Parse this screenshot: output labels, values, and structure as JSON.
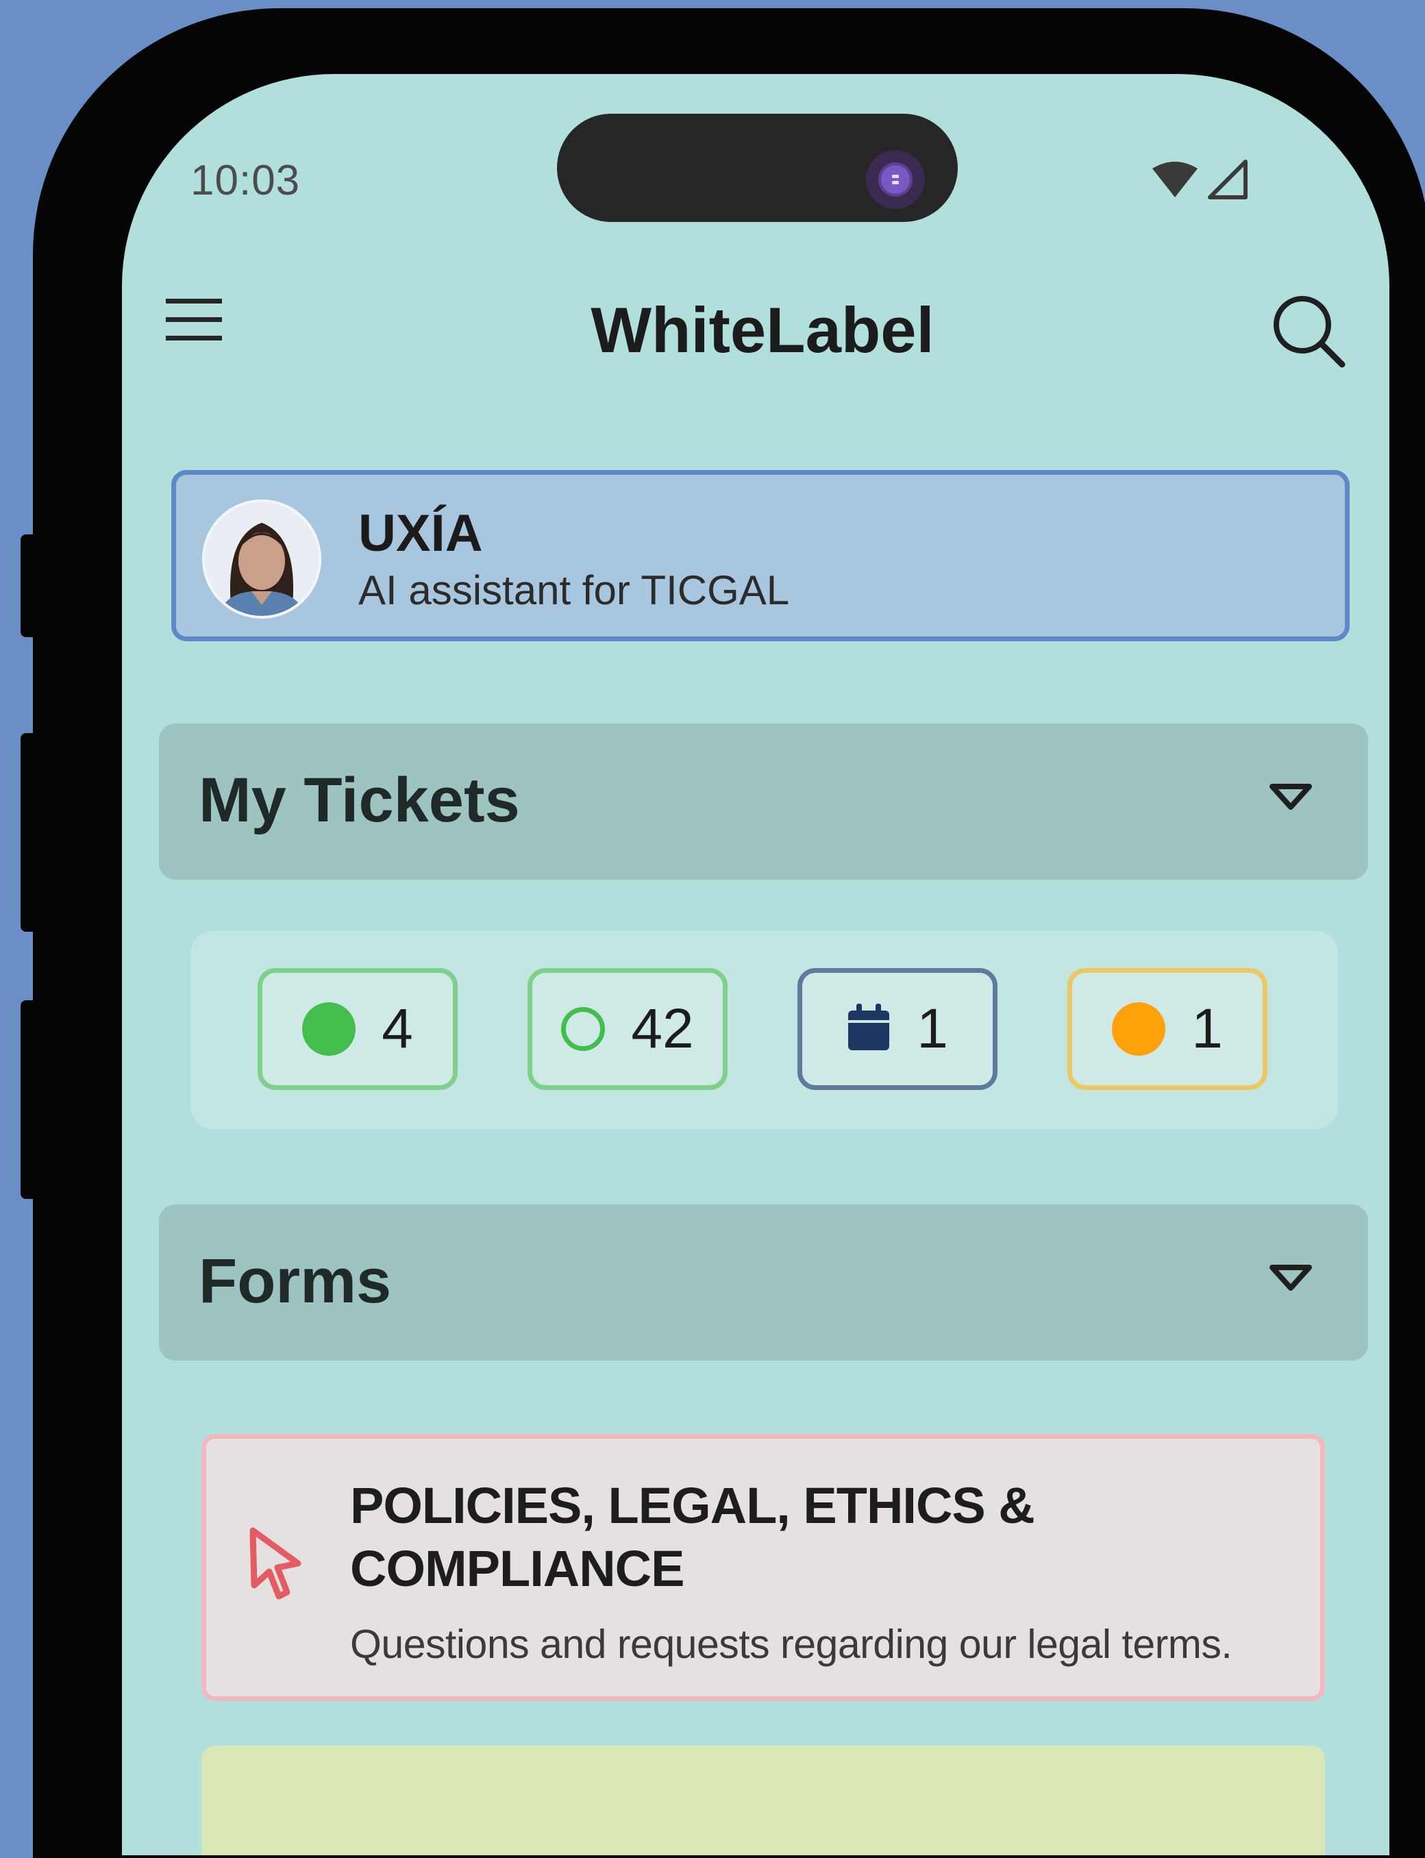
{
  "status_bar": {
    "time": "10:03"
  },
  "app_bar": {
    "title": "WhiteLabel",
    "menu_icon": "hamburger-menu-icon",
    "search_icon": "search-icon"
  },
  "assistant": {
    "name": "UXÍA",
    "subtitle": "AI assistant for TICGAL"
  },
  "tickets": {
    "label": "My Tickets",
    "counters": [
      {
        "icon": "filled-green-circle-icon",
        "count": "4",
        "border": "#7fd08a"
      },
      {
        "icon": "hollow-green-circle-icon",
        "count": "42",
        "border": "#7fd08a"
      },
      {
        "icon": "calendar-icon",
        "count": "1",
        "border": "#5f7a9c"
      },
      {
        "icon": "orange-circle-icon",
        "count": "1",
        "border": "#ecc765"
      }
    ]
  },
  "forms": {
    "label": "Forms",
    "items": [
      {
        "title": "POLICIES, LEGAL, ETHICS & COMPLIANCE",
        "description": "Questions and requests regarding our legal terms.",
        "icon": "cursor-pointer-icon"
      }
    ]
  },
  "colors": {
    "background": "#6a8ec6",
    "screen": "#b1dfdb",
    "section_header": "#9dc4c0",
    "assistant_card": "#a8c6de",
    "assistant_border": "#5f88c8",
    "green": "#43be4e",
    "orange": "#ffa20a",
    "navy": "#1e3662",
    "form_border": "#f1b9bf",
    "cursor_red": "#e45c63"
  }
}
